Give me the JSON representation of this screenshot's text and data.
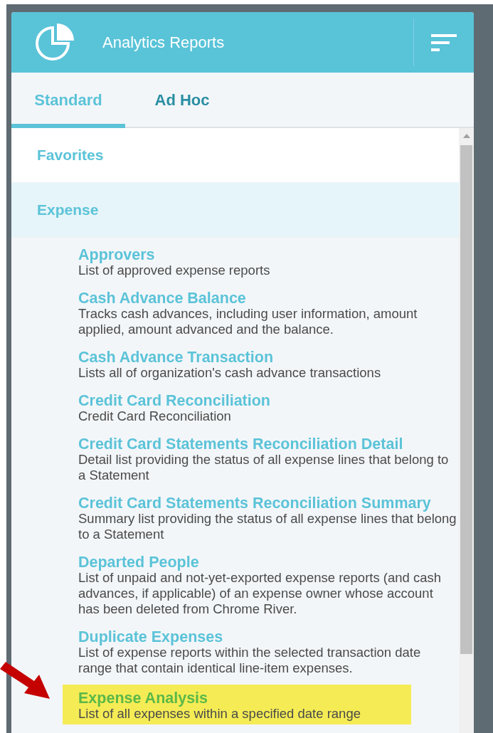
{
  "header": {
    "title": "Analytics Reports"
  },
  "tabs": [
    {
      "label": "Standard",
      "selected": true
    },
    {
      "label": "Ad Hoc",
      "selected": false
    }
  ],
  "categories": [
    {
      "label": "Favorites",
      "expanded": false
    },
    {
      "label": "Expense",
      "expanded": true,
      "items": [
        {
          "title": "Approvers",
          "description": "List of approved expense reports",
          "highlighted": false
        },
        {
          "title": "Cash Advance Balance",
          "description": "Tracks cash advances, including user information, amount applied, amount advanced and the balance.",
          "highlighted": false
        },
        {
          "title": "Cash Advance Transaction",
          "description": "Lists all of organization's cash advance transactions",
          "highlighted": false
        },
        {
          "title": "Credit Card Reconciliation",
          "description": "Credit Card Reconciliation",
          "highlighted": false
        },
        {
          "title": "Credit Card Statements Reconciliation Detail",
          "description": "Detail list providing the status of all expense lines that belong to a Statement",
          "highlighted": false
        },
        {
          "title": "Credit Card Statements Reconciliation Summary",
          "description": "Summary list providing the status of all expense lines that belong to a Statement",
          "highlighted": false
        },
        {
          "title": "Departed People",
          "description": "List of unpaid and not-yet-exported expense reports (and cash advances, if applicable) of an expense owner whose account has been deleted from Chrome River.",
          "highlighted": false
        },
        {
          "title": "Duplicate Expenses",
          "description": "List of expense reports within the selected transaction date range that contain identical line-item expenses.",
          "highlighted": false
        },
        {
          "title": "Expense Analysis",
          "description": "List of all expenses within a specified date range",
          "highlighted": true
        }
      ]
    }
  ]
}
